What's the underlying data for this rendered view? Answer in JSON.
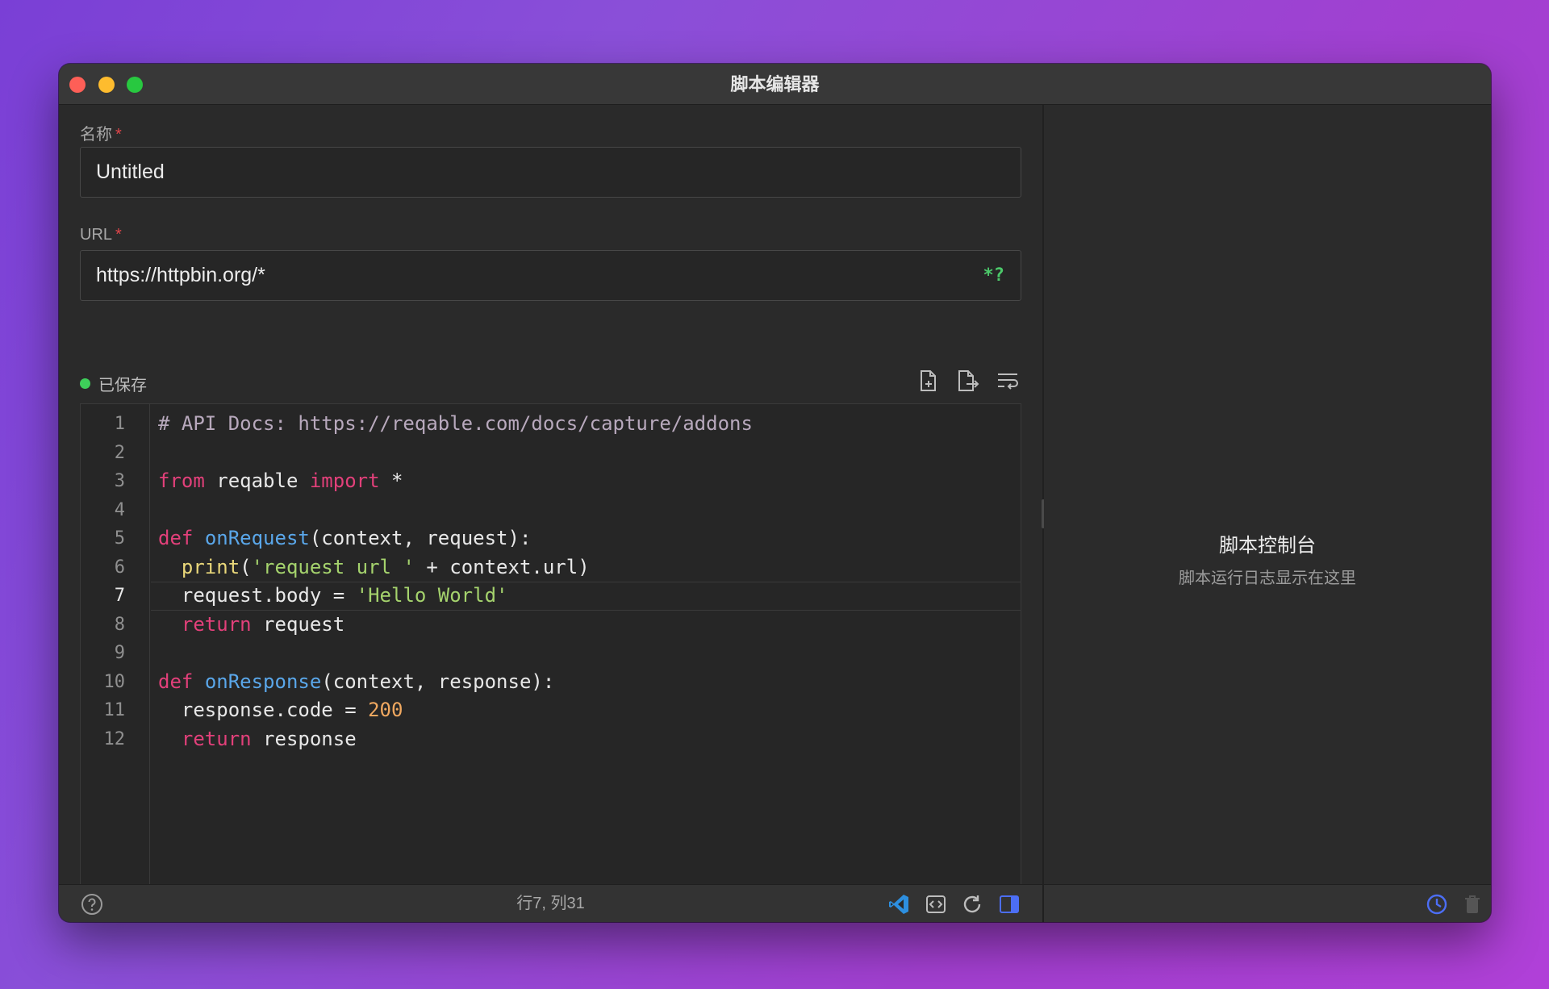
{
  "window": {
    "title": "脚本编辑器"
  },
  "form": {
    "name_label": "名称",
    "name_required": "*",
    "name_value": "Untitled",
    "url_label": "URL",
    "url_required": "*",
    "url_value": "https://httpbin.org/*",
    "regex_toggle": "*?"
  },
  "editor": {
    "status": "已保存",
    "status_color": "#3ecf5a",
    "toolbar_icons": [
      "import-file-icon",
      "export-file-icon",
      "word-wrap-icon"
    ],
    "line_numbers": [
      "1",
      "2",
      "3",
      "4",
      "5",
      "6",
      "7",
      "8",
      "9",
      "10",
      "11",
      "12"
    ],
    "active_line": "7",
    "lines": [
      [
        {
          "t": "# API Docs: https://reqable.com/docs/capture/addons",
          "c": "cm"
        }
      ],
      [],
      [
        {
          "t": "from",
          "c": "kw"
        },
        {
          "t": " reqable ",
          "c": ""
        },
        {
          "t": "import",
          "c": "kw"
        },
        {
          "t": " *",
          "c": ""
        }
      ],
      [],
      [
        {
          "t": "def",
          "c": "kw"
        },
        {
          "t": " ",
          "c": ""
        },
        {
          "t": "onRequest",
          "c": "fn"
        },
        {
          "t": "(context, request):",
          "c": ""
        }
      ],
      [
        {
          "t": "  ",
          "c": ""
        },
        {
          "t": "print",
          "c": "bi"
        },
        {
          "t": "(",
          "c": ""
        },
        {
          "t": "'request url '",
          "c": "st"
        },
        {
          "t": " + context.url)",
          "c": ""
        }
      ],
      [
        {
          "t": "  request.body = ",
          "c": ""
        },
        {
          "t": "'Hello World'",
          "c": "st"
        }
      ],
      [
        {
          "t": "  ",
          "c": ""
        },
        {
          "t": "return",
          "c": "kw"
        },
        {
          "t": " request",
          "c": ""
        }
      ],
      [],
      [
        {
          "t": "def",
          "c": "kw"
        },
        {
          "t": " ",
          "c": ""
        },
        {
          "t": "onResponse",
          "c": "fn"
        },
        {
          "t": "(context, response):",
          "c": ""
        }
      ],
      [
        {
          "t": "  response.code = ",
          "c": ""
        },
        {
          "t": "200",
          "c": "nu"
        }
      ],
      [
        {
          "t": "  ",
          "c": ""
        },
        {
          "t": "return",
          "c": "kw"
        },
        {
          "t": " response",
          "c": ""
        }
      ]
    ]
  },
  "footer": {
    "cursor_position": "行7, 列31",
    "icons": [
      "help-icon",
      "vscode-icon",
      "code-snippet-icon",
      "refresh-icon",
      "toggle-panel-icon"
    ]
  },
  "console": {
    "title": "脚本控制台",
    "subtitle": "脚本运行日志显示在这里",
    "footer_icons": [
      "history-icon",
      "trash-icon"
    ]
  },
  "colors": {
    "accent": "#4c6ef5",
    "vscode_blue": "#2d8fe0",
    "required": "#e0454a"
  }
}
